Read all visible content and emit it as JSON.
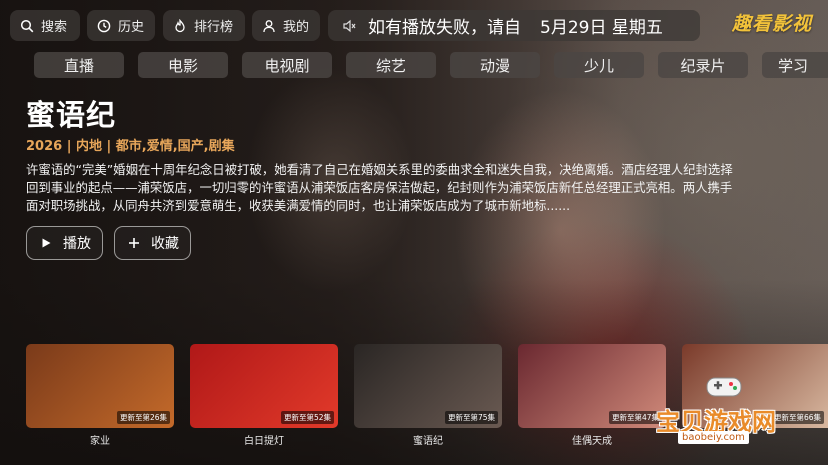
{
  "topbar": {
    "search": "搜索",
    "history": "历史",
    "ranking": "排行榜",
    "mine": "我的",
    "notice": "如有播放失败，请自",
    "date": "5月29日 星期五",
    "logo": "趣看影视"
  },
  "categories": [
    "直播",
    "电影",
    "电视剧",
    "综艺",
    "动漫",
    "少儿",
    "纪录片",
    "学习"
  ],
  "featured": {
    "title": "蜜语纪",
    "meta": "2026 | 内地 | 都市,爱情,国产,剧集",
    "description": "许蜜语的“完美”婚姻在十周年纪念日被打破，她看清了自己在婚姻关系里的委曲求全和迷失自我，决绝离婚。酒店经理人纪封选择回到事业的起点——浦荣饭店，一切归零的许蜜语从浦荣饭店客房保洁做起，纪封则作为浦荣饭店新任总经理正式亮相。两人携手面对职场挑战，从同舟共济到爱意萌生，收获美满爱情的同时，也让浦荣饭店成为了城市新地标......",
    "play": "播放",
    "collect": "收藏"
  },
  "posters": [
    {
      "label": "家业",
      "badge": "更新至第26集",
      "colors": [
        "#7a3a1a",
        "#c46a2a"
      ]
    },
    {
      "label": "白日提灯",
      "badge": "更新至第52集",
      "colors": [
        "#b01818",
        "#e23a2a"
      ]
    },
    {
      "label": "蜜语纪",
      "badge": "更新至第75集",
      "colors": [
        "#2a2624",
        "#6a5a52"
      ]
    },
    {
      "label": "佳偶天成",
      "badge": "更新至第47集",
      "colors": [
        "#6a2830",
        "#d08a7a"
      ]
    },
    {
      "label": "",
      "badge": "更新至第66集",
      "colors": [
        "#7a3a2a",
        "#d8b8a0"
      ]
    }
  ],
  "watermark": {
    "main": "宝贝游戏网",
    "sub": "baobeiy.com"
  }
}
